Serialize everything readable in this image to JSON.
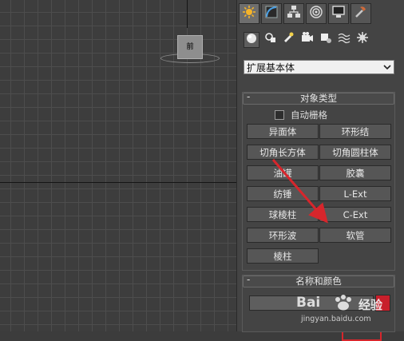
{
  "viewport": {
    "viewcube_label": "前"
  },
  "panel": {
    "tabs": [
      {
        "icon": "create-icon",
        "active": true
      },
      {
        "icon": "modify-icon",
        "active": false
      },
      {
        "icon": "hierarchy-icon",
        "active": false
      },
      {
        "icon": "motion-icon",
        "active": false
      },
      {
        "icon": "display-icon",
        "active": false
      },
      {
        "icon": "utilities-icon",
        "active": false
      }
    ],
    "subtypes": [
      {
        "icon": "geometry-icon",
        "active": true
      },
      {
        "icon": "shapes-icon",
        "active": false
      },
      {
        "icon": "lights-icon",
        "active": false
      },
      {
        "icon": "cameras-icon",
        "active": false
      },
      {
        "icon": "helpers-icon",
        "active": false
      },
      {
        "icon": "space-warps-icon",
        "active": false
      },
      {
        "icon": "systems-icon",
        "active": false
      }
    ],
    "category_dropdown": "扩展基本体",
    "object_type": {
      "title": "对象类型",
      "collapse_symbol": "-",
      "autogrid_label": "自动栅格",
      "buttons": [
        "异面体",
        "环形结",
        "切角长方体",
        "切角圆柱体",
        "油罐",
        "胶囊",
        "纺锤",
        "L-Ext",
        "球棱柱",
        "C-Ext",
        "环形波",
        "软管",
        "棱柱"
      ]
    },
    "name_color": {
      "title": "名称和颜色",
      "collapse_symbol": "-",
      "name_value": "",
      "color_swatch": "#c81f2b"
    }
  },
  "annotation": {
    "highlight_color": "#d7262c",
    "highlight_target": "软管"
  },
  "watermark": {
    "brand_left": "Bai",
    "brand_right": "经验",
    "url": "jingyan.baidu.com"
  }
}
